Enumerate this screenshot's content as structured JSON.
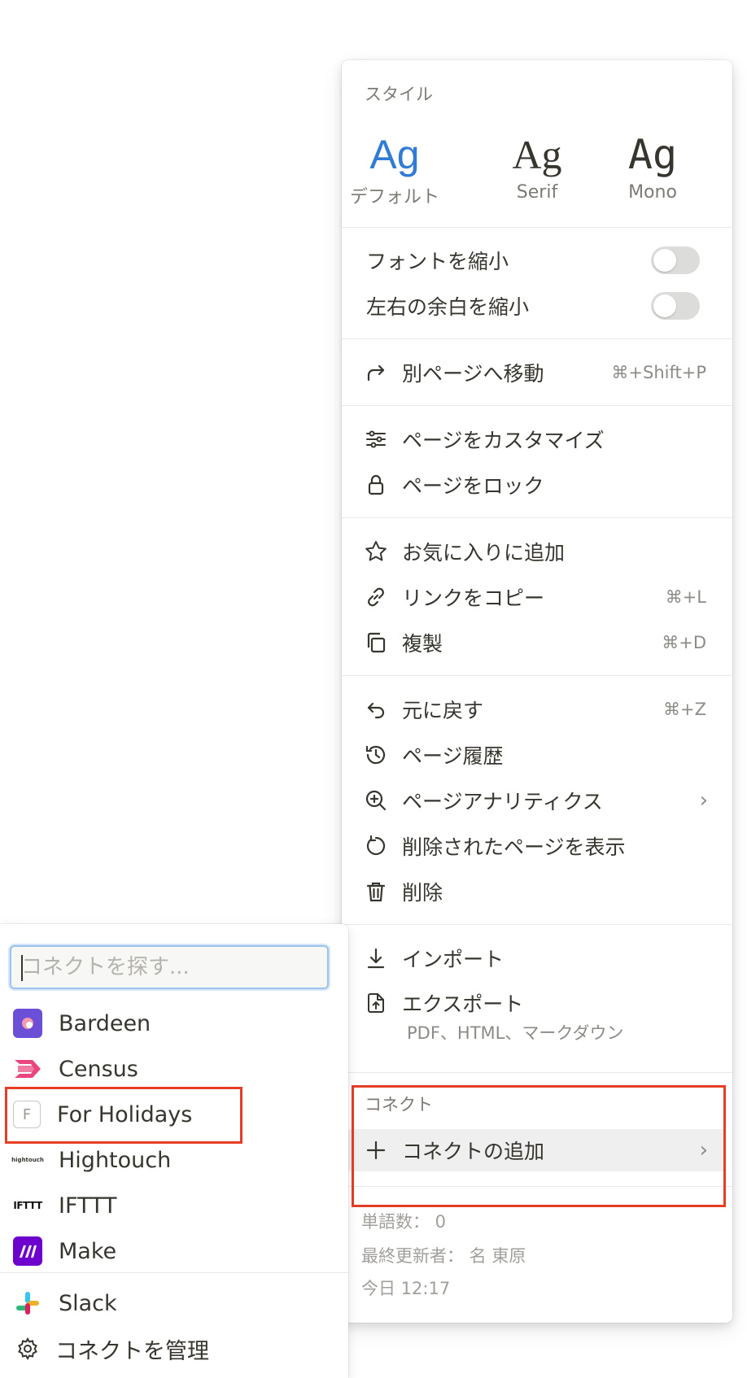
{
  "page_menu": {
    "style_title": "スタイル",
    "styles": [
      {
        "glyph": "Ag",
        "label": "デフォルト",
        "selected": true
      },
      {
        "glyph": "Ag",
        "label": "Serif",
        "selected": false
      },
      {
        "glyph": "Ag",
        "label": "Mono",
        "selected": false
      }
    ],
    "toggles": [
      {
        "label": "フォントを縮小",
        "on": false
      },
      {
        "label": "左右の余白を縮小",
        "on": false
      }
    ],
    "move": {
      "label": "別ページへ移動",
      "shortcut": "⌘+Shift+P"
    },
    "customize": {
      "label": "ページをカスタマイズ"
    },
    "lock": {
      "label": "ページをロック"
    },
    "favorite": {
      "label": "お気に入りに追加"
    },
    "copy_link": {
      "label": "リンクをコピー",
      "shortcut": "⌘+L"
    },
    "duplicate": {
      "label": "複製",
      "shortcut": "⌘+D"
    },
    "undo": {
      "label": "元に戻す",
      "shortcut": "⌘+Z"
    },
    "history": {
      "label": "ページ履歴"
    },
    "analytics": {
      "label": "ページアナリティクス"
    },
    "deleted_pages": {
      "label": "削除されたページを表示"
    },
    "delete": {
      "label": "削除"
    },
    "import": {
      "label": "インポート"
    },
    "export": {
      "label": "エクスポート",
      "sub": "PDF、HTML、マークダウン"
    },
    "connect_title": "コネクト",
    "add_connect": {
      "label": "コネクトの追加"
    },
    "word_count": "単語数： 0",
    "last_editor": "最終更新者： 名 東原",
    "last_edited": "今日 12:17"
  },
  "connect_submenu": {
    "search_placeholder": "コネクトを探す...",
    "items": [
      {
        "label": "Bardeen",
        "icon": "bardeen-logo"
      },
      {
        "label": "Census",
        "icon": "census-logo"
      },
      {
        "label": "For Holidays",
        "icon": "f-letter-icon",
        "icon_text": "F",
        "highlighted": true
      },
      {
        "label": "Hightouch",
        "icon": "hightouch-logo",
        "icon_text": "hightouch"
      },
      {
        "label": "IFTTT",
        "icon": "ifttt-logo",
        "icon_text": "IFTTT"
      },
      {
        "label": "Make",
        "icon": "make-logo"
      },
      {
        "label": "Slack",
        "icon": "slack-logo"
      },
      {
        "label": "コネクトを管理",
        "icon": "gear-icon"
      }
    ]
  },
  "colors": {
    "accent": "#2f7bd6",
    "highlight": "#e53e25"
  }
}
